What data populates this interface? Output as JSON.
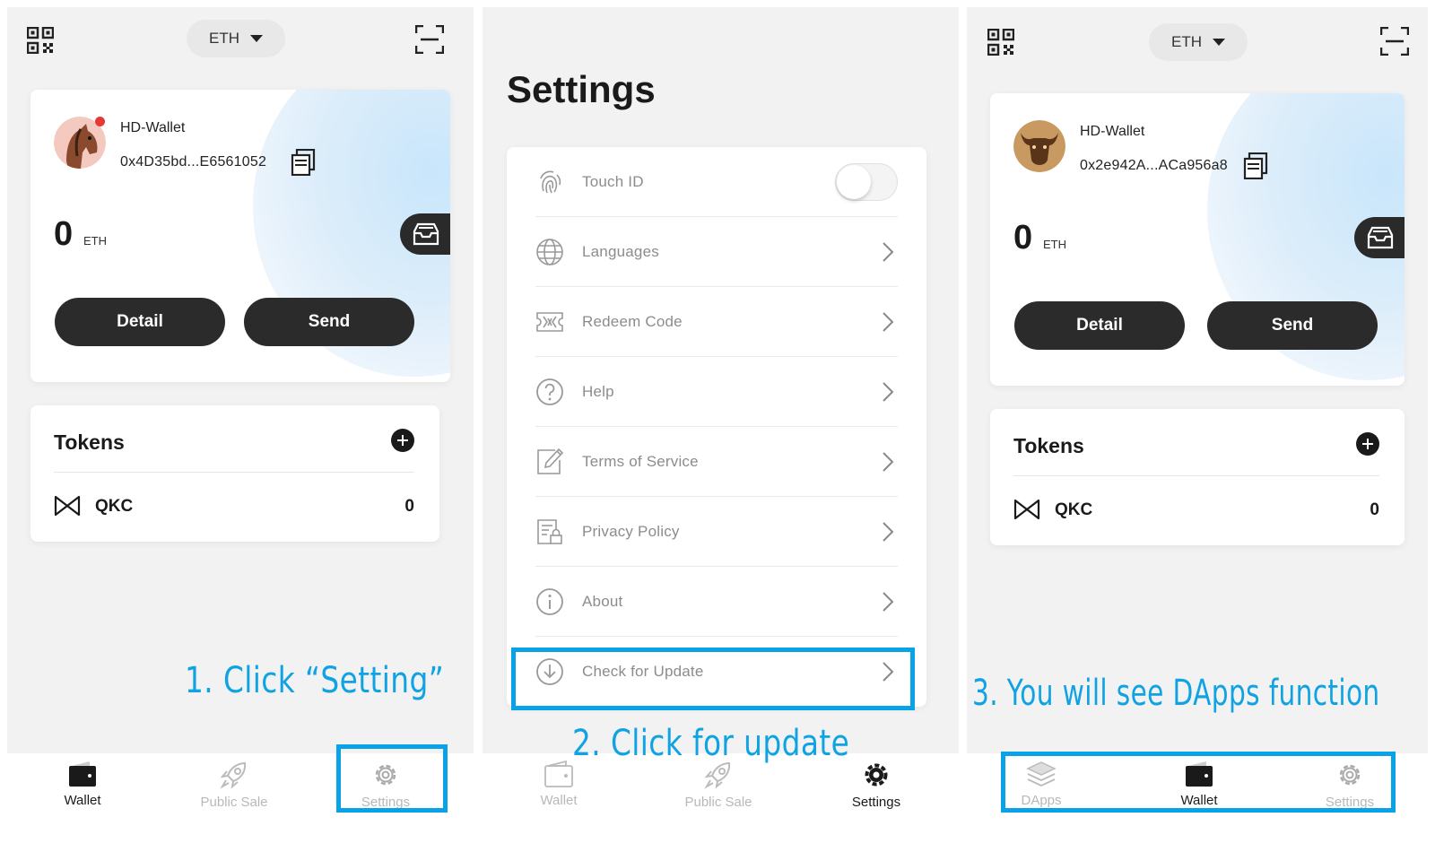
{
  "colors": {
    "accent": "#0aa2e6",
    "dark_button": "#2b2b2b",
    "panel_bg": "#f2f2f2"
  },
  "panel1": {
    "network": "ETH",
    "wallet_name": "HD-Wallet",
    "address": "0x4D35bd...E6561052",
    "balance": "0",
    "balance_unit": "ETH",
    "detail_label": "Detail",
    "send_label": "Send",
    "tokens_title": "Tokens",
    "token": {
      "symbol": "QKC",
      "amount": "0"
    },
    "tabs": [
      {
        "label": "Wallet",
        "icon": "wallet-icon"
      },
      {
        "label": "Public Sale",
        "icon": "rocket-icon"
      },
      {
        "label": "Settings",
        "icon": "gear-icon"
      }
    ],
    "annotation": "1. Click “Setting”"
  },
  "panel2": {
    "title": "Settings",
    "rows": [
      {
        "label": "Touch ID",
        "icon": "fingerprint-icon"
      },
      {
        "label": "Languages",
        "icon": "globe-icon"
      },
      {
        "label": "Redeem Code",
        "icon": "ticket-icon"
      },
      {
        "label": "Help",
        "icon": "help-icon"
      },
      {
        "label": "Terms of Service",
        "icon": "edit-document-icon"
      },
      {
        "label": "Privacy Policy",
        "icon": "lock-document-icon"
      },
      {
        "label": "About",
        "icon": "info-icon"
      },
      {
        "label": "Check for Update",
        "icon": "download-icon"
      }
    ],
    "touch_id_enabled": false,
    "tabs": [
      {
        "label": "Wallet",
        "icon": "wallet-icon"
      },
      {
        "label": "Public Sale",
        "icon": "rocket-icon"
      },
      {
        "label": "Settings",
        "icon": "gear-icon"
      }
    ],
    "annotation": "2. Click for update"
  },
  "panel3": {
    "network": "ETH",
    "wallet_name": "HD-Wallet",
    "address": "0x2e942A...ACa956a8",
    "balance": "0",
    "balance_unit": "ETH",
    "detail_label": "Detail",
    "send_label": "Send",
    "tokens_title": "Tokens",
    "token": {
      "symbol": "QKC",
      "amount": "0"
    },
    "tabs": [
      {
        "label": "DApps",
        "icon": "layers-icon"
      },
      {
        "label": "Wallet",
        "icon": "wallet-icon"
      },
      {
        "label": "Settings",
        "icon": "gear-icon"
      }
    ],
    "annotation": "3. You will see DApps function"
  }
}
